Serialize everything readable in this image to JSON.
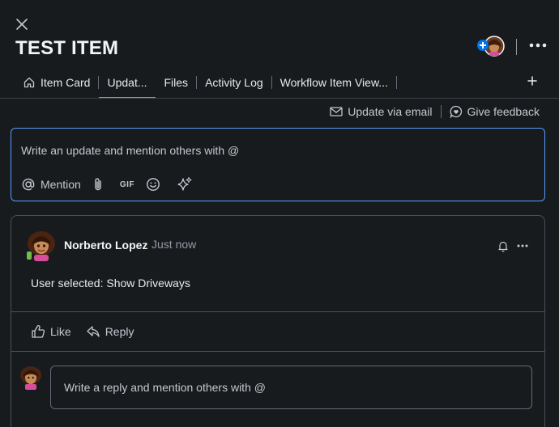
{
  "header": {
    "title": "TEST ITEM"
  },
  "tabs": [
    {
      "label": "Item Card",
      "icon": "home-icon"
    },
    {
      "label": "Updat...",
      "active": true
    },
    {
      "label": "Files"
    },
    {
      "label": "Activity Log"
    },
    {
      "label": "Workflow Item View..."
    }
  ],
  "actions": {
    "email_label": "Update via email",
    "feedback_label": "Give feedback"
  },
  "composer": {
    "placeholder": "Write an update and mention others with @",
    "mention_label": "Mention",
    "gif_label": "GIF"
  },
  "post": {
    "author": "Norberto Lopez",
    "time": "Just now",
    "body": "User selected: Show Driveways",
    "like_label": "Like",
    "reply_label": "Reply",
    "reply_placeholder": "Write a reply and mention others with @"
  },
  "colors": {
    "background": "#181b1e",
    "accent": "#579bfc",
    "border": "#4b4e5a"
  }
}
